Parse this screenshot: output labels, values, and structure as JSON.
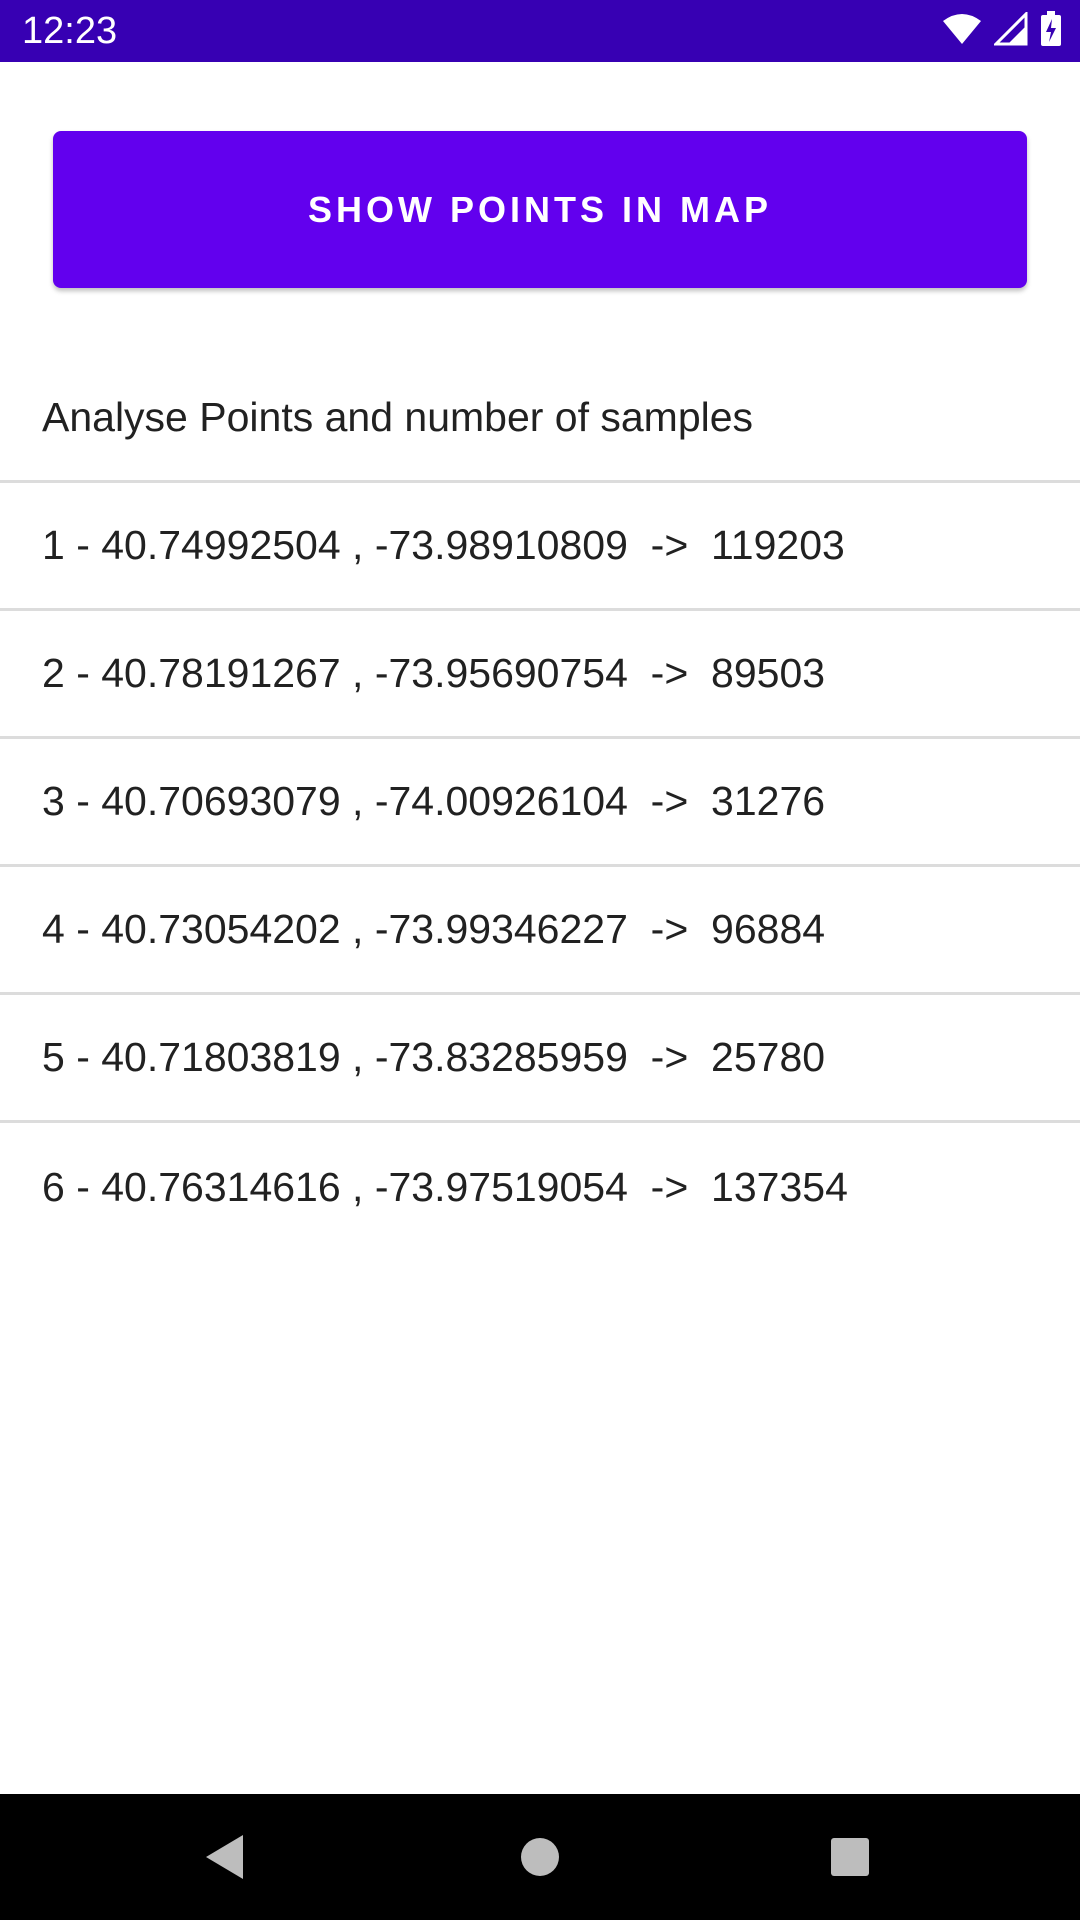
{
  "status_bar": {
    "time": "12:23",
    "icons": [
      "wifi-icon",
      "cell-signal-icon",
      "battery-charging-icon"
    ],
    "background": "#3700b3"
  },
  "main": {
    "show_points_button_label": "SHOW POINTS IN MAP",
    "accent_color": "#6200ee",
    "list": {
      "header": "Analyse Points and number of samples",
      "items": [
        "1 - 40.74992504 , -73.98910809  ->  119203",
        "2 - 40.78191267 , -73.95690754  ->  89503",
        "3 - 40.70693079 , -74.00926104  ->  31276",
        "4 - 40.73054202 , -73.99346227  ->  96884",
        "5 - 40.71803819 , -73.83285959  ->  25780",
        "6 - 40.76314616 , -73.97519054  ->  137354"
      ]
    }
  },
  "nav_bar": {
    "icons": [
      "back-icon",
      "home-icon",
      "recents-icon"
    ]
  }
}
